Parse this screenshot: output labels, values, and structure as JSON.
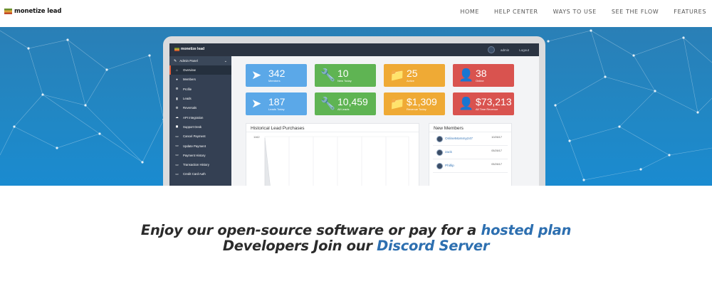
{
  "nav": {
    "brand": "monetize lead",
    "links": [
      "HOME",
      "HELP CENTER",
      "WAYS TO USE",
      "SEE THE FLOW",
      "FEATURES"
    ]
  },
  "app": {
    "brand": "monetize lead",
    "user": "admin",
    "logout": "Logout",
    "sidebar_header": "Admin Panel",
    "sidebar_items": [
      {
        "label": "Overview",
        "icon": "home-icon"
      },
      {
        "label": "Members",
        "icon": "user-icon"
      },
      {
        "label": "Profile",
        "icon": "gear-icon"
      },
      {
        "label": "Leads",
        "icon": "chart-icon"
      },
      {
        "label": "Reversals",
        "icon": "gear-icon"
      },
      {
        "label": "API Integration",
        "icon": "cloud-icon"
      },
      {
        "label": "Support Desk",
        "icon": "truck-icon"
      },
      {
        "label": "Cancel Payment",
        "icon": "card-icon"
      },
      {
        "label": "Update Payment",
        "icon": "card-icon"
      },
      {
        "label": "Payment History",
        "icon": "card-icon"
      },
      {
        "label": "Transaction History",
        "icon": "card-icon"
      },
      {
        "label": "Credit Card Auth",
        "icon": "card-icon"
      }
    ],
    "stats_row1": [
      {
        "value": "342",
        "label": "Members",
        "color": "#5ba8e8",
        "icon": "paper-plane-icon"
      },
      {
        "value": "10",
        "label": "New Today",
        "color": "#5fb453",
        "icon": "wrench-icon"
      },
      {
        "value": "25",
        "label": "Active",
        "color": "#efaa35",
        "icon": "folder-icon"
      },
      {
        "value": "38",
        "label": "Online",
        "color": "#d9534f",
        "icon": "user-icon"
      }
    ],
    "stats_row2": [
      {
        "value": "187",
        "label": "Leads Today",
        "color": "#5ba8e8",
        "icon": "paper-plane-icon"
      },
      {
        "value": "10,459",
        "label": "All Leads",
        "color": "#5fb453",
        "icon": "wrench-icon"
      },
      {
        "value": "$1,309",
        "label": "Revenue Today",
        "color": "#efaa35",
        "icon": "folder-icon"
      },
      {
        "value": "$73,213",
        "label": "All Time Revenue",
        "color": "#d9534f",
        "icon": "user-icon"
      }
    ],
    "chart_title": "Historical Lead Purchases",
    "chart_axis_label": "1162",
    "members_title": "New Members",
    "members": [
      {
        "name": "OnlineMommy247",
        "date": "10/26/17"
      },
      {
        "name": "zack",
        "date": "05/26/17"
      },
      {
        "name": "Phillip",
        "date": "05/26/17"
      }
    ]
  },
  "tagline": {
    "line1_prefix": "Enjoy our open-source software or pay for a ",
    "line1_link": "hosted plan",
    "line2_prefix": "Developers Join our ",
    "line2_link": "Discord Server"
  }
}
